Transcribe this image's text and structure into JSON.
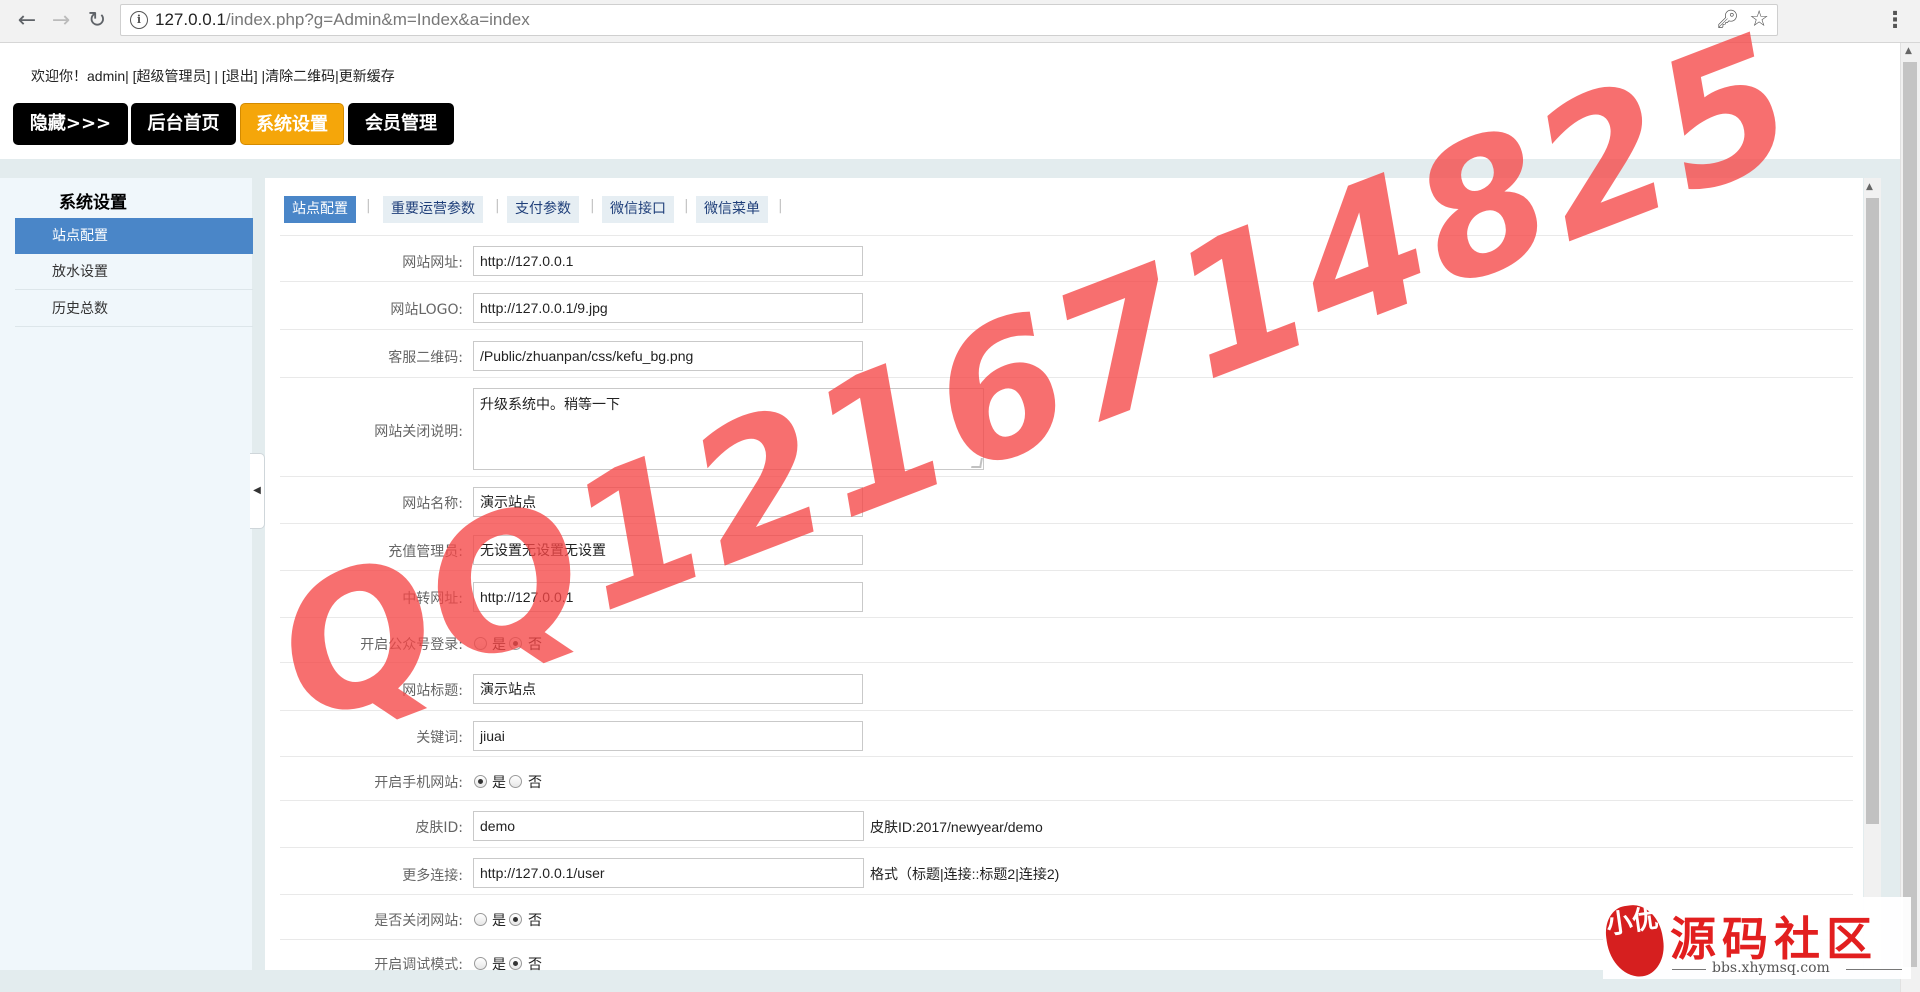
{
  "browser": {
    "url_host": "127.0.0.1",
    "url_path": "/index.php?g=Admin&m=Index&a=index"
  },
  "header": {
    "welcome": "欢迎你！admin| [超级管理员] | [退出] |清除二维码|更新缓存",
    "buttons": [
      "隐藏>>>",
      "后台首页",
      "系统设置",
      "会员管理"
    ],
    "active_button": "系统设置",
    "active_color": "#f5a60a"
  },
  "sidebar": {
    "title": "系统设置",
    "items": [
      "站点配置",
      "放水设置",
      "历史总数"
    ],
    "active_item": "站点配置"
  },
  "tabs": [
    "站点配置",
    "重要运营参数",
    "支付参数",
    "微信接口",
    "微信菜单"
  ],
  "tab_separator": "|",
  "form": {
    "site_url": {
      "label": "网站网址:",
      "value": "http://127.0.0.1"
    },
    "site_logo": {
      "label": "网站LOGO:",
      "value": "http://127.0.0.1/9.jpg"
    },
    "kefu_qrcode": {
      "label": "客服二维码:",
      "value": "/Public/zhuanpan/css/kefu_bg.png"
    },
    "close_desc": {
      "label": "网站关闭说明:",
      "value": "升级系统中。稍等一下"
    },
    "site_name": {
      "label": "网站名称:",
      "value": "演示站点"
    },
    "recharge_admin": {
      "label": "充值管理员:",
      "value": "无设置无设置无设置"
    },
    "relay_url": {
      "label": "中转网址:",
      "value": "http://127.0.0.1"
    },
    "wechat_login": {
      "label": "开启公众号登录:",
      "yes": "是",
      "no": "否",
      "selected": "否"
    },
    "site_title": {
      "label": "网站标题:",
      "value": "演示站点"
    },
    "keywords": {
      "label": "关键词:",
      "value": "jiuai"
    },
    "mobile_site": {
      "label": "开启手机网站:",
      "yes": "是",
      "no": "否",
      "selected": "是"
    },
    "skin_id": {
      "label": "皮肤ID:",
      "value": "demo",
      "hint": "皮肤ID:2017/newyear/demo"
    },
    "more_links": {
      "label": "更多连接:",
      "value": "http://127.0.0.1/user",
      "hint": "格式（标题|连接::标题2|连接2)"
    },
    "close_site": {
      "label": "是否关闭网站:",
      "yes": "是",
      "no": "否",
      "selected": "否"
    },
    "debug_mode": {
      "label": "开启调试模式:",
      "yes": "是",
      "no": "否",
      "selected": "否"
    }
  },
  "watermark": "QQ1216714825",
  "logo": {
    "seal": "小优",
    "name": "源码社区",
    "url": "bbs.xhymsq.com"
  },
  "colors": {
    "accent_blue": "#4a86c8",
    "watermark_red": "#f54646"
  }
}
